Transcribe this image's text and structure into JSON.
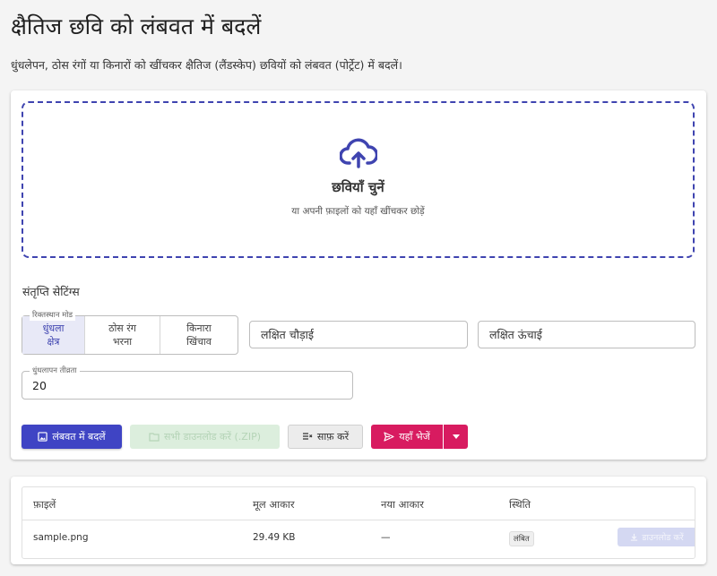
{
  "page": {
    "title": "क्षैतिज छवि को लंबवत में बदलें",
    "description": "धुंधलेपन, ठोस रंगों या किनारों को खींचकर क्षैतिज (लैंडस्केप) छवियों को लंबवत (पोर्ट्रेट) में बदलें।"
  },
  "dropzone": {
    "title": "छवियाँ चुनें",
    "subtitle": "या अपनी फ़ाइलों को यहाँ खींचकर छोड़ें",
    "icon": "cloud-upload-icon"
  },
  "settings": {
    "heading": "संतृप्ति सेटिंग्स",
    "mode_legend": "रिक्तस्थान मोड",
    "modes": [
      {
        "label": "धुंधला\nक्षेत्र",
        "selected": true
      },
      {
        "label": "ठोस रंग\nभरना",
        "selected": false
      },
      {
        "label": "किनारा\nखिंचाव",
        "selected": false
      }
    ],
    "target_width_placeholder": "लक्षित चौड़ाई",
    "target_height_placeholder": "लक्षित ऊंचाई",
    "blur_legend": "धुंधलापन तीव्रता",
    "blur_value": "20"
  },
  "actions": {
    "convert": "लंबवत में बदलें",
    "download_all": "सभी डाउनलोड करें (.ZIP)",
    "clear": "साफ़ करें",
    "send": "यहाँ भेजें"
  },
  "files": {
    "columns": [
      "फ़ाइलें",
      "मूल आकार",
      "नया आकार",
      "स्थिति"
    ],
    "rows": [
      {
        "name": "sample.png",
        "original_size": "29.49 KB",
        "new_size": "—",
        "status": "लंबित",
        "download_label": "डाउनलोड करें"
      }
    ]
  },
  "colors": {
    "primary": "#3f44c4",
    "accent": "#d81b60",
    "dropzone_border": "#3f44b0"
  }
}
